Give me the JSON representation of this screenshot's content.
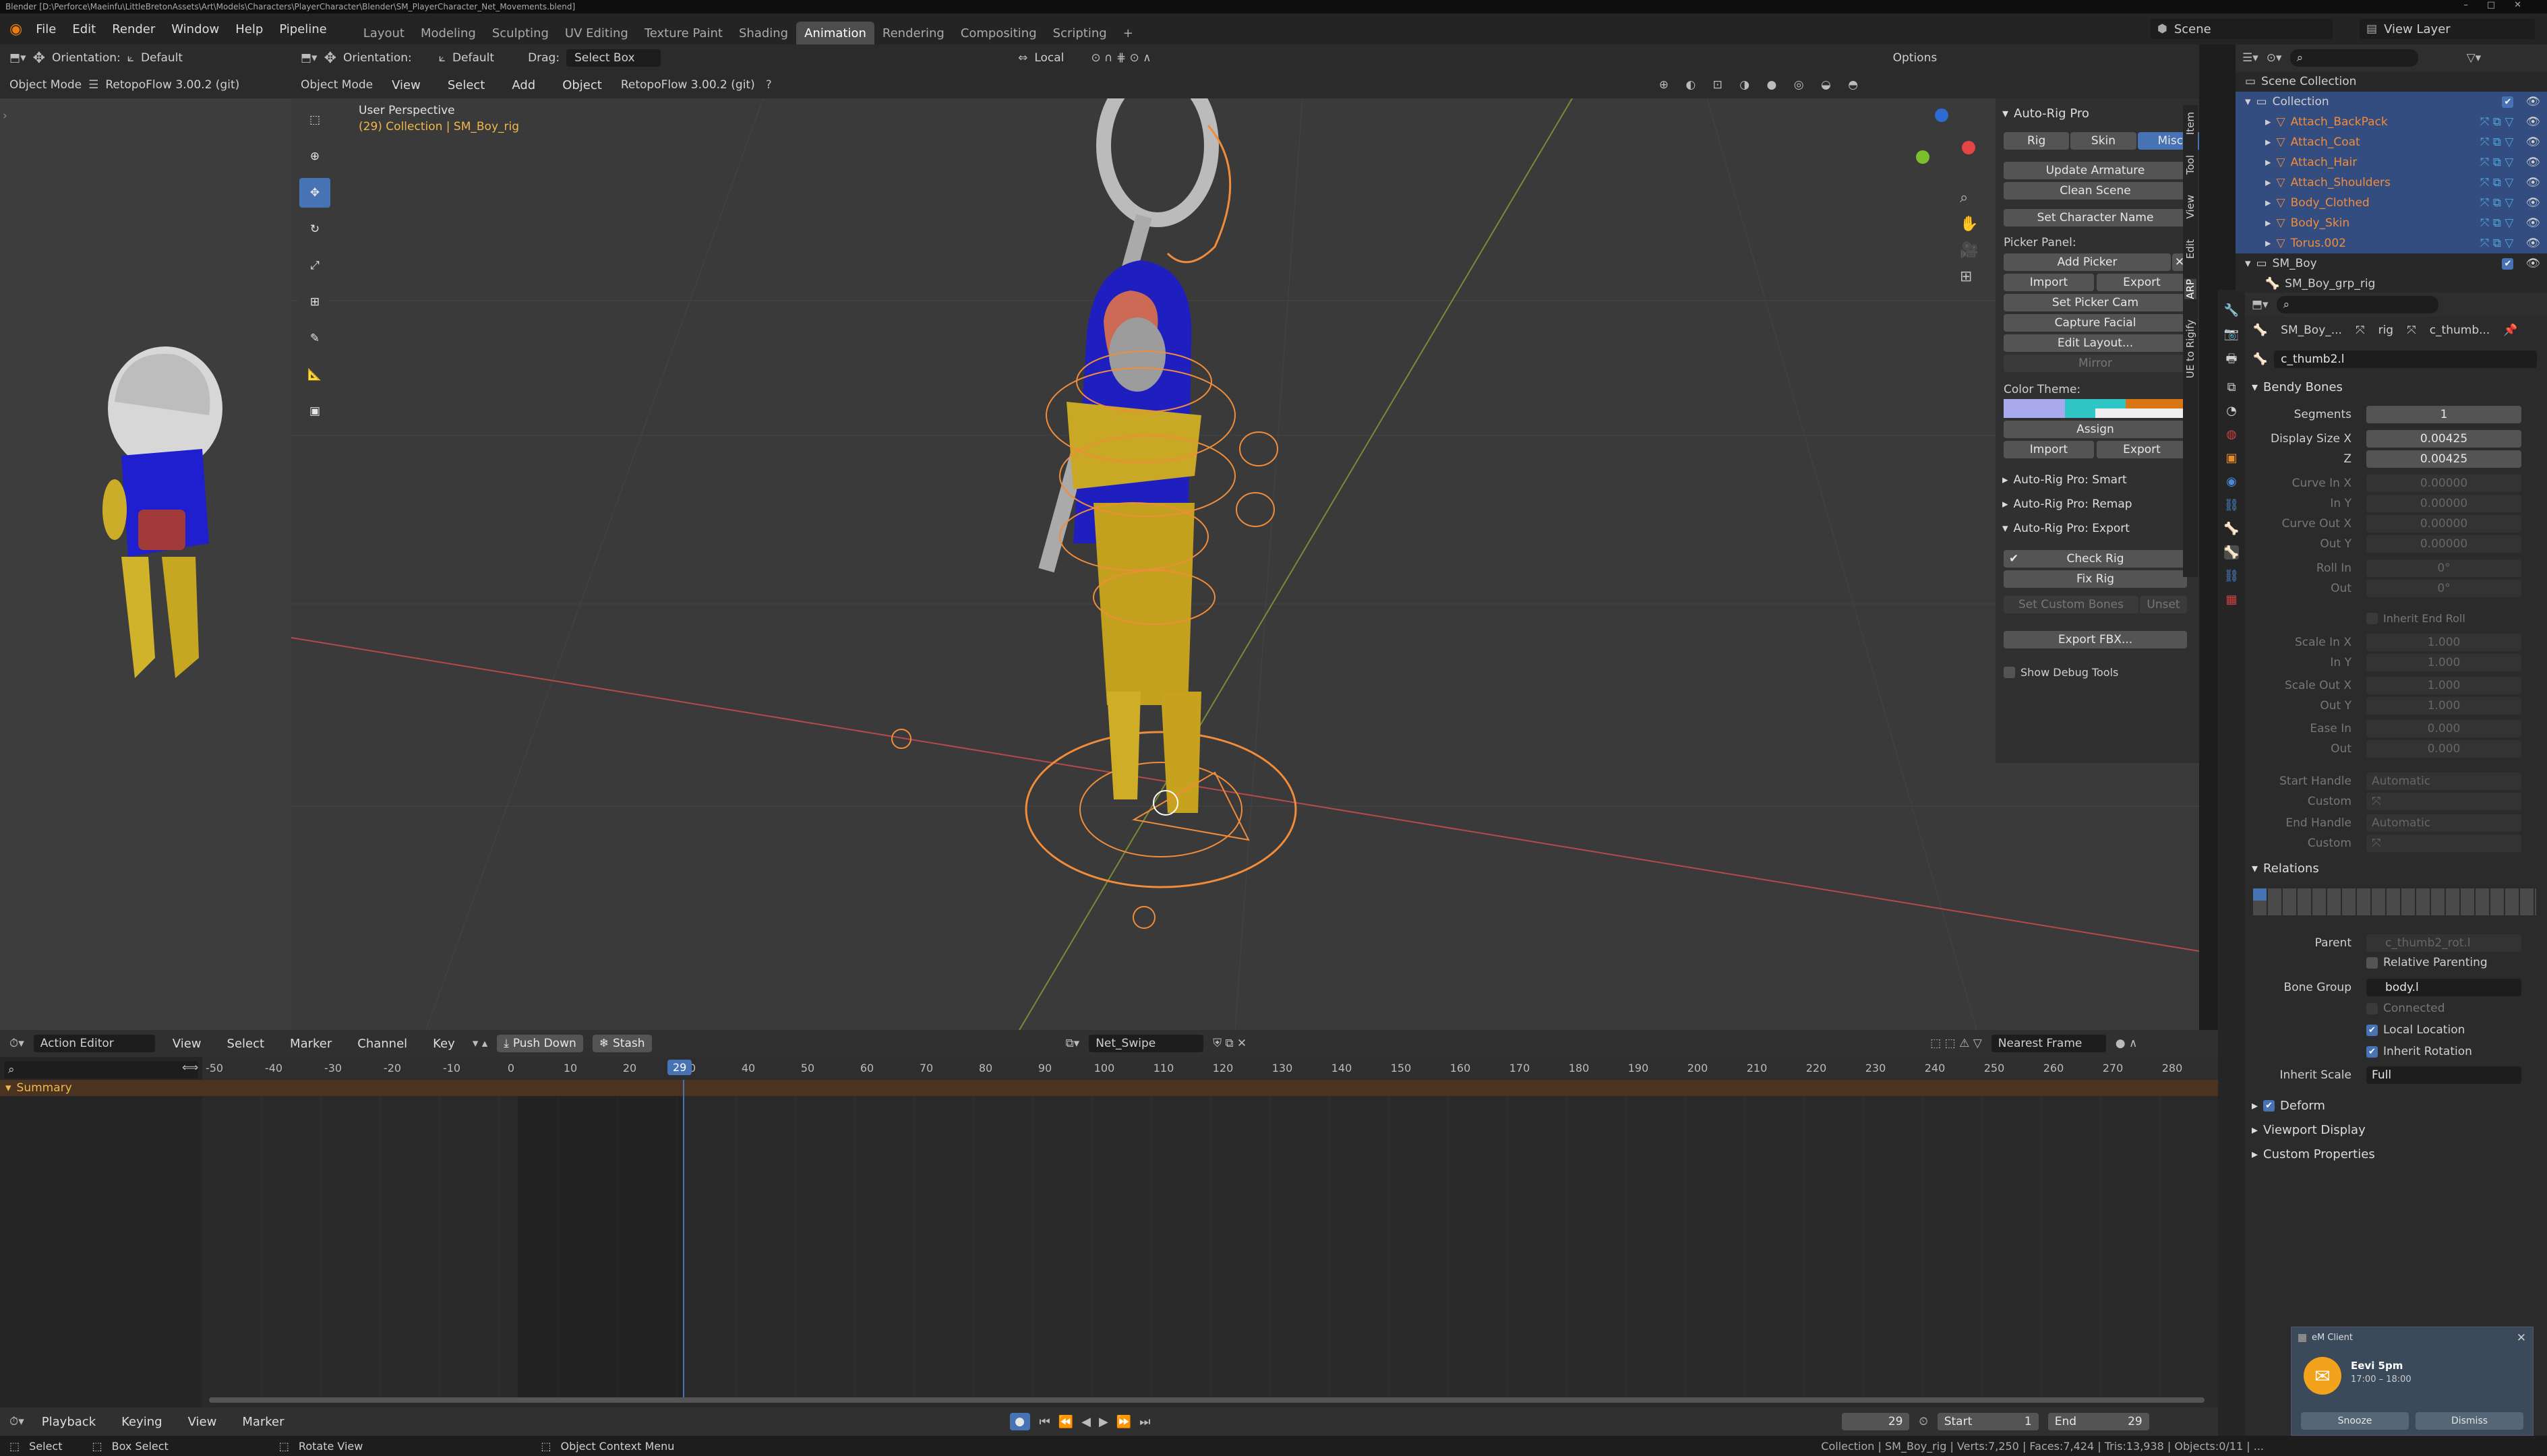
{
  "window": {
    "title": "Blender [D:\\Perforce\\Maeinfu\\LittleBretonAssets\\Art\\Models\\Characters\\PlayerCharacter\\Blender\\SM_PlayerCharacter_Net_Movements.blend]"
  },
  "menus": [
    "File",
    "Edit",
    "Render",
    "Window",
    "Help",
    "Pipeline"
  ],
  "workspaces": [
    {
      "label": "Layout",
      "active": false
    },
    {
      "label": "Modeling",
      "active": false
    },
    {
      "label": "Sculpting",
      "active": false
    },
    {
      "label": "UV Editing",
      "active": false
    },
    {
      "label": "Texture Paint",
      "active": false
    },
    {
      "label": "Shading",
      "active": false
    },
    {
      "label": "Animation",
      "active": true
    },
    {
      "label": "Rendering",
      "active": false
    },
    {
      "label": "Compositing",
      "active": false
    },
    {
      "label": "Scripting",
      "active": false
    }
  ],
  "topright": {
    "scene": "Scene",
    "view_layer": "View Layer"
  },
  "left_header": {
    "mode": "Object Mode",
    "orientation_label": "Orientation:",
    "orientation_value": "Default",
    "addon": "RetopoFlow 3.00.2 (git)"
  },
  "viewport_header": {
    "orientation_label": "Orientation:",
    "orientation_value": "Default",
    "drag_label": "Drag:",
    "drag_value": "Select Box",
    "pivot": "Local",
    "options": "Options",
    "mode": "Object Mode",
    "menus": [
      "View",
      "Select",
      "Add",
      "Object"
    ],
    "addon": "RetopoFlow 3.00.2 (git)"
  },
  "viewport": {
    "perspective": "User Perspective",
    "collection_info": "(29) Collection | SM_Boy_rig"
  },
  "side_tabs": [
    "Item",
    "Tool",
    "View",
    "Edit",
    "ARP",
    "UE to Rigify"
  ],
  "autorig": {
    "title": "Auto-Rig Pro",
    "tabs": [
      {
        "label": "Rig",
        "active": false
      },
      {
        "label": "Skin",
        "active": false
      },
      {
        "label": "Misc",
        "active": true
      }
    ],
    "update_armature": "Update Armature",
    "clean_scene": "Clean Scene",
    "set_character_name": "Set Character Name",
    "picker_label": "Picker Panel:",
    "add_picker": "Add Picker",
    "import": "Import",
    "export": "Export",
    "set_picker_cam": "Set Picker Cam",
    "capture_facial": "Capture Facial",
    "edit_layout": "Edit Layout...",
    "mirror": "Mirror",
    "color_theme": "Color Theme:",
    "assign": "Assign",
    "smart": "Auto-Rig Pro: Smart",
    "remap": "Auto-Rig Pro: Remap",
    "export_panel": "Auto-Rig Pro: Export",
    "check_rig": "Check Rig",
    "fix_rig": "Fix Rig",
    "set_custom_bones": "Set Custom Bones",
    "unset": "Unset",
    "export_fbx": "Export FBX...",
    "show_debug": "Show Debug Tools",
    "theme_colors": [
      "#a9a9ee",
      "#31c6c6",
      "#d97512",
      "#eeeeee"
    ]
  },
  "outliner": {
    "root": "Scene Collection",
    "collection": "Collection",
    "items": [
      "Attach_BackPack",
      "Attach_Coat",
      "Attach_Hair",
      "Attach_Shoulders",
      "Body_Clothed",
      "Body_Skin",
      "Torus.002"
    ],
    "sm_boy": "SM_Boy",
    "sm_boy_rig": "SM_Boy_grp_rig"
  },
  "properties": {
    "breadcrumb": [
      "SM_Boy_...",
      "rig",
      "c_thumb..."
    ],
    "bone_name": "c_thumb2.l",
    "bendy_bones": "Bendy Bones",
    "rows": [
      {
        "label": "Segments",
        "value": "1",
        "enabled": true
      },
      {
        "label": "Display Size X",
        "value": "0.00425",
        "enabled": true
      },
      {
        "label": "Z",
        "value": "0.00425",
        "enabled": true
      },
      {
        "label": "Curve In X",
        "value": "0.00000",
        "enabled": false
      },
      {
        "label": "In Y",
        "value": "0.00000",
        "enabled": false
      },
      {
        "label": "Curve Out X",
        "value": "0.00000",
        "enabled": false
      },
      {
        "label": "Out Y",
        "value": "0.00000",
        "enabled": false
      },
      {
        "label": "Roll In",
        "value": "0°",
        "enabled": false
      },
      {
        "label": "Out",
        "value": "0°",
        "enabled": false
      }
    ],
    "inherit_end_roll": "Inherit End Roll",
    "rows2": [
      {
        "label": "Scale In X",
        "value": "1.000"
      },
      {
        "label": "In Y",
        "value": "1.000"
      },
      {
        "label": "Scale Out X",
        "value": "1.000"
      },
      {
        "label": "Out Y",
        "value": "1.000"
      },
      {
        "label": "Ease In",
        "value": "0.000"
      },
      {
        "label": "Out",
        "value": "0.000"
      }
    ],
    "start_handle": {
      "label": "Start Handle",
      "value": "Automatic"
    },
    "custom": "Custom",
    "end_handle": {
      "label": "End Handle",
      "value": "Automatic"
    },
    "relations": "Relations",
    "parent_label": "Parent",
    "parent_value": "c_thumb2_rot.l",
    "relative_parenting": "Relative Parenting",
    "bone_group_label": "Bone Group",
    "bone_group_value": "body.l",
    "connected": "Connected",
    "local_location": "Local Location",
    "inherit_rotation": "Inherit Rotation",
    "inherit_scale_label": "Inherit Scale",
    "inherit_scale_value": "Full",
    "deform": "Deform",
    "viewport_display": "Viewport Display",
    "custom_properties": "Custom Properties"
  },
  "action_editor": {
    "mode": "Action Editor",
    "menus": [
      "View",
      "Select",
      "Marker",
      "Channel",
      "Key"
    ],
    "push_down": "Push Down",
    "stash": "Stash",
    "action": "Net_Swipe",
    "snap": "Nearest Frame",
    "current_frame": "29",
    "ticks": [
      "-50",
      "-40",
      "-30",
      "-20",
      "-10",
      "0",
      "10",
      "20",
      "30",
      "40",
      "50",
      "60",
      "70",
      "80",
      "90",
      "100",
      "110",
      "120",
      "130",
      "140",
      "150",
      "160",
      "170",
      "180",
      "190",
      "200",
      "210",
      "220",
      "230",
      "240",
      "250",
      "260",
      "270",
      "280"
    ],
    "summary": "Summary"
  },
  "timeline": {
    "menus": [
      "Playback",
      "Keying",
      "View",
      "Marker"
    ],
    "frame": "29",
    "start_label": "Start",
    "start": "1",
    "end_label": "End",
    "end": "29"
  },
  "statusbar": {
    "select": "Select",
    "box_select": "Box Select",
    "rotate_view": "Rotate View",
    "context_menu": "Object Context Menu",
    "stats": "Collection | SM_Boy_rig | Verts:7,250 | Faces:7,424 | Tris:13,938 | Objects:0/11 | ..."
  },
  "notification": {
    "app": "eM Client",
    "title": "Eevi 5pm",
    "time": "17:00 – 18:00",
    "snooze": "Snooze",
    "dismiss": "Dismiss"
  },
  "colors": {
    "accent": "#4772b3",
    "selected_rig": "#f08c3a",
    "active_frame": "#4772b3"
  }
}
